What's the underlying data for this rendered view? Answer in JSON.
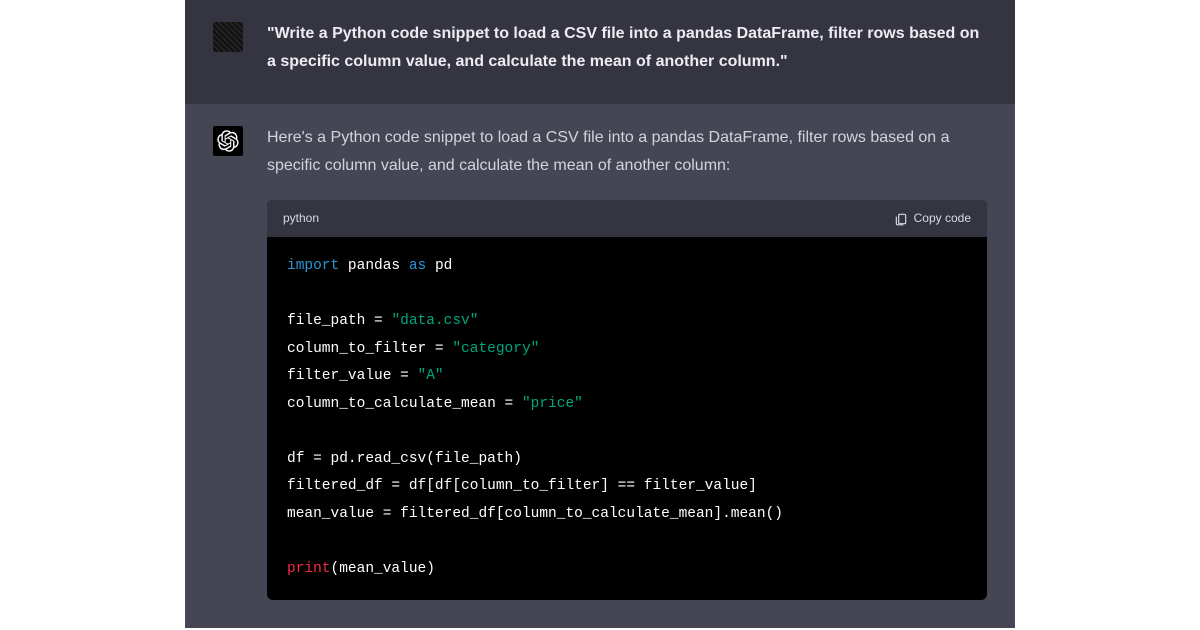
{
  "user_message": {
    "text": "\"Write a Python code snippet to load a CSV file into a pandas DataFrame, filter rows based on a specific column value, and calculate the mean of another column.\""
  },
  "assistant_message": {
    "intro": "Here's a Python code snippet to load a CSV file into a pandas DataFrame, filter rows based on a specific column value, and calculate the mean of another column:"
  },
  "code_block": {
    "language": "python",
    "copy_label": "Copy code",
    "tokens": {
      "import": "import",
      "as": "as",
      "pandas": "pandas",
      "pd": "pd",
      "file_path": "file_path",
      "eq": " = ",
      "data_csv": "\"data.csv\"",
      "column_to_filter": "column_to_filter",
      "category": "\"category\"",
      "filter_value": "filter_value",
      "A": "\"A\"",
      "column_to_calculate_mean": "column_to_calculate_mean",
      "price": "\"price\"",
      "df": "df",
      "read_csv_call": "pd.read_csv(file_path)",
      "filtered_df": "filtered_df",
      "filter_expr": "df[df[column_to_filter] == filter_value]",
      "mean_value": "mean_value",
      "mean_expr": "filtered_df[column_to_calculate_mean].mean()",
      "print": "print",
      "print_arg": "(mean_value)"
    }
  }
}
